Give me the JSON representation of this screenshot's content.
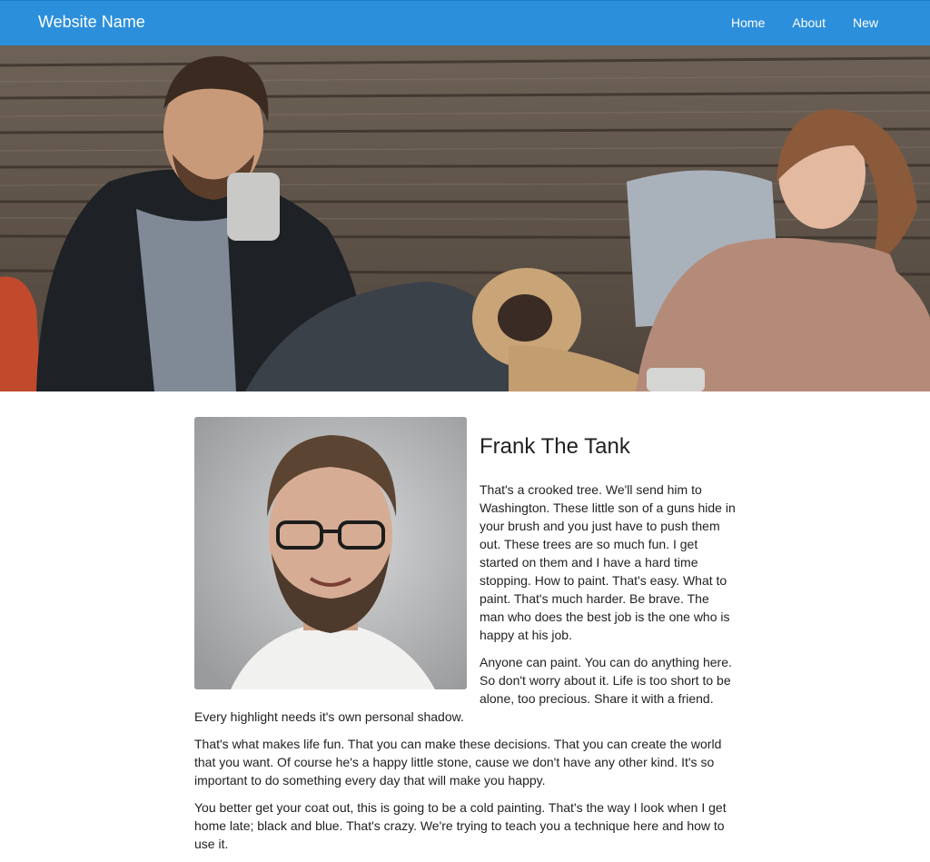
{
  "navbar": {
    "brand": "Website Name",
    "links": [
      {
        "label": "Home"
      },
      {
        "label": "About"
      },
      {
        "label": "New"
      }
    ],
    "color": "#2c8fdb"
  },
  "hero": {
    "icon": "hero-photo-people-with-dog"
  },
  "profile": {
    "icon": "portrait-photo",
    "name": "Frank The Tank",
    "paragraphs": [
      "That's a crooked tree. We'll send him to Washington. These little son of a guns hide in your brush and you just have to push them out. These trees are so much fun. I get started on them and I have a hard time stopping. How to paint. That's easy. What to paint. That's much harder. Be brave. The man who does the best job is the one who is happy at his job.",
      "Anyone can paint. You can do anything here. So don't worry about it. Life is too short to be alone, too precious. Share it with a friend. Every highlight needs it's own personal shadow.",
      "That's what makes life fun. That you can make these decisions. That you can create the world that you want. Of course he's a happy little stone, cause we don't have any other kind. It's so important to do something every day that will make you happy.",
      "You better get your coat out, this is going to be a cold painting. That's the way I look when I get home late; black and blue. That's crazy. We're trying to teach you a technique here and how to use it."
    ]
  }
}
